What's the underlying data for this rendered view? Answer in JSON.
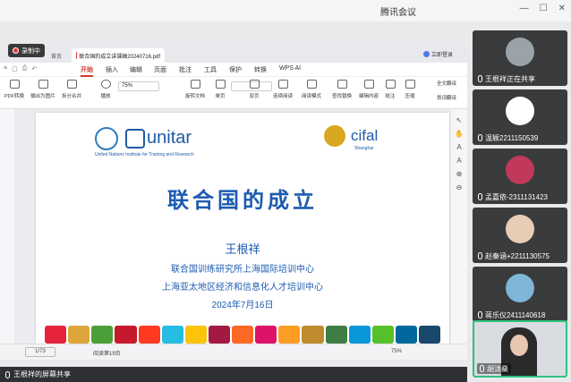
{
  "meeting": {
    "app_title": "腾讯会议",
    "window_controls": [
      "—",
      "☐",
      "✕"
    ],
    "recording_label": "录制中",
    "share_status_label": "王根祥的屏幕共享"
  },
  "wps": {
    "tabs": [
      {
        "label": "首页"
      },
      {
        "label": "联合国的成立讲课稿20240716.pdf"
      }
    ],
    "login_label": "立即登录",
    "menu": [
      "开始",
      "插入",
      "编辑",
      "页面",
      "批注",
      "工具",
      "保护",
      "转换",
      "WPS AI"
    ],
    "active_menu": "开始",
    "toolbar": [
      {
        "label": "PDF转换"
      },
      {
        "label": "输出为图片"
      },
      {
        "label": "拆分合并"
      },
      {
        "label": "播放"
      },
      {
        "label": "旋转文档"
      },
      {
        "label": "单页"
      },
      {
        "label": "双页"
      },
      {
        "label": "连续阅读"
      },
      {
        "label": "阅读模式"
      },
      {
        "label": "查找替换"
      },
      {
        "label": "编辑内容"
      },
      {
        "label": "批注"
      },
      {
        "label": "压缩"
      },
      {
        "label": "全文翻译"
      },
      {
        "label": "划词翻译"
      }
    ],
    "zoom_value": "75%",
    "status_page": "1/73",
    "status_total": "阅读第19页",
    "status_zoom": "75%"
  },
  "slide": {
    "unitar_word": "unitar",
    "unitar_sub": "United Nations Institute for Training and Research",
    "cifal_word": "cifal",
    "cifal_sub": "Shanghai",
    "title": "联合国的成立",
    "author": "王根祥",
    "org1": "联合国训练研究所上海国际培训中心",
    "org2": "上海亚太地区经济和信息化人才培训中心",
    "date": "2024年7月16日",
    "sdg_colors": [
      "#e5243b",
      "#dda63a",
      "#4c9f38",
      "#c5192d",
      "#ff3a21",
      "#26bde2",
      "#fcc30b",
      "#a21942",
      "#fd6925",
      "#dd1367",
      "#fd9d24",
      "#bf8b2e",
      "#3f7e44",
      "#0a97d9",
      "#56c02b",
      "#00689d",
      "#19486a"
    ]
  },
  "participants": [
    {
      "name": "王根祥正在共享",
      "avatar_color": "#9aa4a8"
    },
    {
      "name": "温颖2211150539",
      "avatar_color": "#ffffff"
    },
    {
      "name": "孟嘉依-2311131423",
      "avatar_color": "#c0395a"
    },
    {
      "name": "赵秦涵+2211130575",
      "avatar_color": "#e7cdb6"
    },
    {
      "name": "蒋乐仪2411140618",
      "avatar_color": "#7fb6d8"
    },
    {
      "name": "胡泷燊",
      "avatar_color": "#2a2a2a"
    }
  ]
}
